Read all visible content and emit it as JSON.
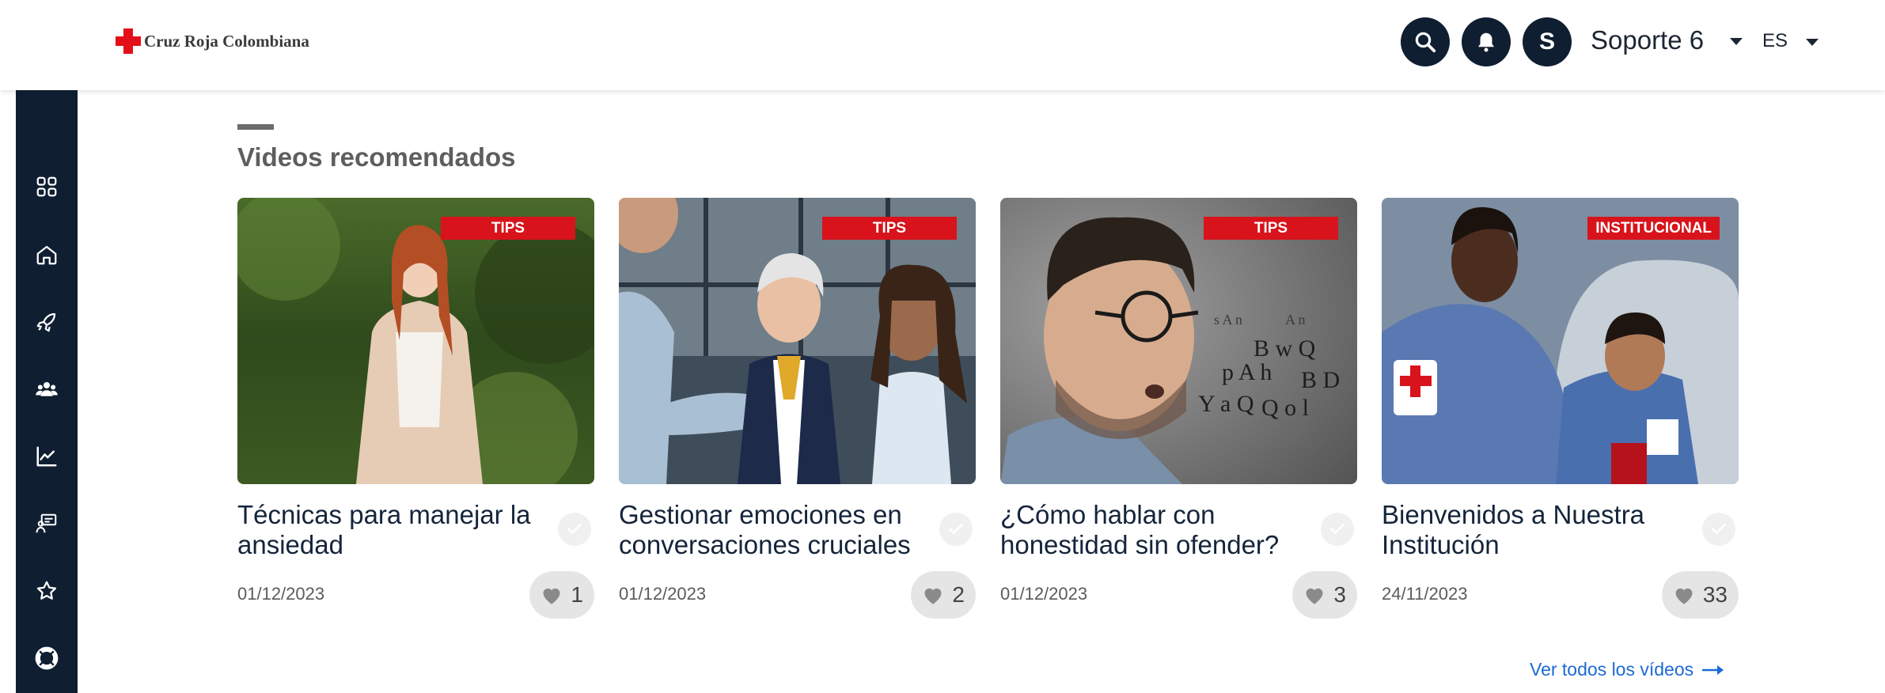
{
  "header": {
    "logo_text": "Cruz Roja Colombiana",
    "avatar_initial": "S",
    "user_name": "Soporte 6",
    "language": "ES"
  },
  "section": {
    "title": "Videos recomendados",
    "see_all": "Ver todos los vídeos"
  },
  "videos": [
    {
      "badge": "TIPS",
      "title": "Técnicas para manejar la ansiedad",
      "date": "01/12/2023",
      "likes": "1"
    },
    {
      "badge": "TIPS",
      "title": "Gestionar emociones en conversaciones cruciales",
      "date": "01/12/2023",
      "likes": "2"
    },
    {
      "badge": "TIPS",
      "title": "¿Cómo hablar con honestidad sin ofender?",
      "date": "01/12/2023",
      "likes": "3"
    },
    {
      "badge": "INSTITUCIONAL",
      "title": "Bienvenidos a Nuestra Institución",
      "date": "24/11/2023",
      "likes": "33"
    }
  ],
  "colors": {
    "navy": "#0f1e31",
    "brand_red": "#d8131b",
    "link_blue": "#1b6ad6"
  },
  "icons": [
    "search-icon",
    "bell-icon",
    "dashboard-icon",
    "home-icon",
    "rocket-icon",
    "users-icon",
    "chart-icon",
    "teacher-icon",
    "star-icon",
    "lifebuoy-icon",
    "heart-icon",
    "check-icon",
    "arrow-right-icon"
  ]
}
